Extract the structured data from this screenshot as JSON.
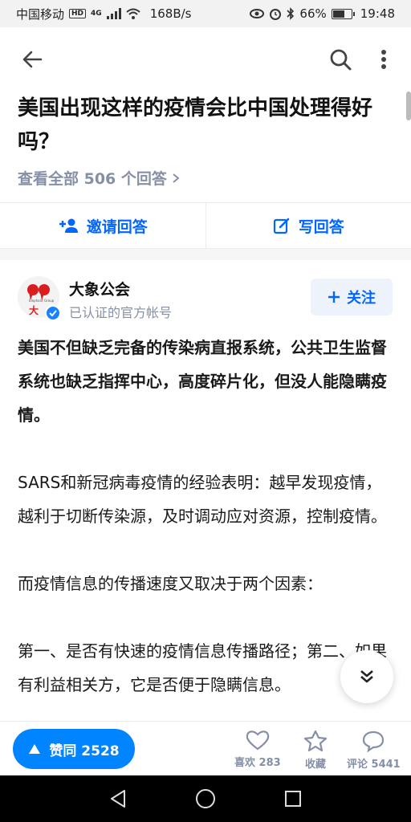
{
  "status_bar": {
    "carrier": "中国移动",
    "hd": "HD",
    "net": "4G",
    "speed": "168B/s",
    "battery": "66%",
    "battery_level": 0.66,
    "time": "19:48"
  },
  "nav": {
    "back_icon": "back-arrow-icon",
    "search_icon": "search-icon",
    "more_icon": "more-vertical-icon"
  },
  "question": {
    "title": "美国出现这样的疫情会比中国处理得好吗？",
    "answers_link": "查看全部 506 个回答"
  },
  "actions": {
    "invite_label": "邀请回答",
    "write_label": "写回答"
  },
  "author": {
    "name": "大象公会",
    "description": "已认证的官方帐号",
    "follow_label": "关注",
    "avatar_text": "大",
    "avatar_small": "Elephant Group"
  },
  "answer": {
    "paragraphs": [
      "美国不但缺乏完备的传染病直报系统，公共卫生监督系统也缺乏指挥中心，高度碎片化，但没人能隐瞒疫情。",
      "SARS和新冠病毒疫情的经验表明：越早发现疫情，越利于切断传染源，及时调动应对资源，控制疫情。",
      "而疫情信息的传播速度又取决于两个因素：",
      "第一、是否有快速的疫情信息传播路径；第二、如果有利益相关方，它是否便于隐瞒信息。"
    ]
  },
  "bottom": {
    "vote_label": "赞同 2528",
    "like_label": "喜欢 283",
    "collect_label": "收藏",
    "comment_label": "评论 5441"
  },
  "colors": {
    "accent": "#0066ff",
    "vote": "#0084ff",
    "muted": "#8590a6"
  }
}
